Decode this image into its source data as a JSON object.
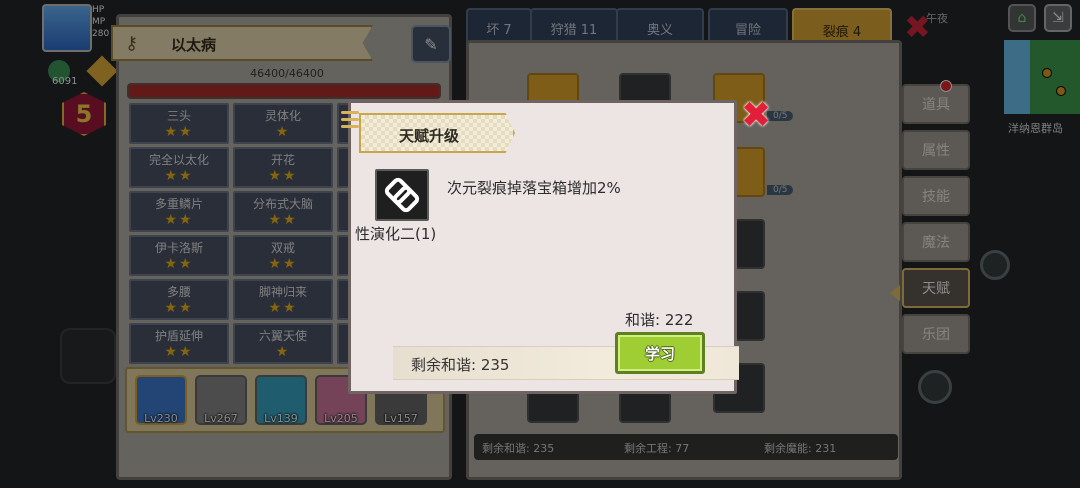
{
  "hud": {
    "gold_value": "6091",
    "level": "5",
    "hp_label": "HP",
    "mp_label": "MP",
    "power": "280"
  },
  "map": {
    "label": "洋纳恩群岛",
    "time": "午夜"
  },
  "left_panel": {
    "title": "以太病",
    "hp_text": "46400/46400",
    "hp_fraction": 1.0,
    "talents": [
      {
        "name": "三头",
        "stars": "★★"
      },
      {
        "name": "灵体化",
        "stars": "★"
      },
      {
        "name": "",
        "stars": ""
      },
      {
        "name": "完全以太化",
        "stars": "★★"
      },
      {
        "name": "开花",
        "stars": "★★"
      },
      {
        "name": "",
        "stars": ""
      },
      {
        "name": "多重鳞片",
        "stars": "★★"
      },
      {
        "name": "分布式大脑",
        "stars": "★★"
      },
      {
        "name": "",
        "stars": ""
      },
      {
        "name": "伊卡洛斯",
        "stars": "★★"
      },
      {
        "name": "双戒",
        "stars": "★★"
      },
      {
        "name": "",
        "stars": ""
      },
      {
        "name": "多腰",
        "stars": "★★"
      },
      {
        "name": "脚神归来",
        "stars": "★★"
      },
      {
        "name": "",
        "stars": ""
      },
      {
        "name": "护盾延伸",
        "stars": "★★"
      },
      {
        "name": "六翼天使",
        "stars": "★"
      },
      {
        "name": "",
        "stars": ""
      }
    ],
    "characters": [
      {
        "level": "Lv230",
        "color": "#3f7fd6"
      },
      {
        "level": "Lv267",
        "color": "#8a8a8a"
      },
      {
        "level": "Lv139",
        "color": "#3aa9c9"
      },
      {
        "level": "Lv205",
        "color": "#d37aa0"
      },
      {
        "level": "Lv157",
        "color": "#6a6a6a"
      }
    ]
  },
  "tabs": [
    {
      "label": "坏 7"
    },
    {
      "label": "狩猎 11"
    },
    {
      "label": "奥义"
    },
    {
      "label": "冒险"
    },
    {
      "label": "裂痕 4"
    }
  ],
  "side_tabs": [
    {
      "label": "道具"
    },
    {
      "label": "属性"
    },
    {
      "label": "技能"
    },
    {
      "label": "魔法"
    },
    {
      "label": "天赋"
    },
    {
      "label": "乐团"
    }
  ],
  "board": {
    "node_count_1": "0/5",
    "node_count_2": "0/5",
    "footer": {
      "harmony": "剩余和谐: 235",
      "engineering": "剩余工程: 77",
      "magic": "剩余魔能: 231"
    }
  },
  "modal": {
    "title": "天赋升级",
    "skill_name": "性演化二(1)",
    "description": "次元裂痕掉落宝箱增加2%",
    "cost": "和谐: 222",
    "remaining": "剩余和谐:  235",
    "learn_label": "学习"
  },
  "colors": {
    "accent_gold": "#e0a935",
    "learn_green": "#9fce34",
    "close_red": "#e21e3a"
  }
}
